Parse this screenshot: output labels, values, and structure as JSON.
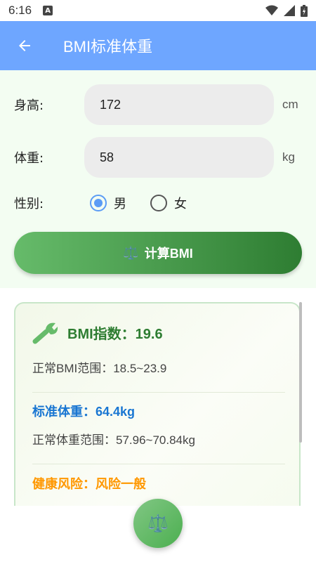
{
  "status_bar": {
    "time": "6:16",
    "a_icon": "A"
  },
  "app_bar": {
    "title": "BMI标准体重"
  },
  "form": {
    "height_label": "身高:",
    "height_value": "172",
    "height_unit": "cm",
    "weight_label": "体重:",
    "weight_value": "58",
    "weight_unit": "kg",
    "gender_label": "性别:",
    "gender_options": [
      "男",
      "女"
    ],
    "gender_selected": "男"
  },
  "calc_button": {
    "icon": "⚖️",
    "label": "计算BMI"
  },
  "result": {
    "bmi_title": "BMI指数：19.6",
    "bmi_range": "正常BMI范围：18.5~23.9",
    "std_weight": "标准体重：64.4kg",
    "weight_range": "正常体重范围：57.96~70.84kg",
    "risk": "健康风险：风险一般"
  },
  "fab": {
    "icon": "⚖️"
  },
  "colors": {
    "app_bar": "#6ea6ff",
    "accent_green": "#2e7d32",
    "blue_text": "#1976d2",
    "orange_text": "#ff9800"
  }
}
